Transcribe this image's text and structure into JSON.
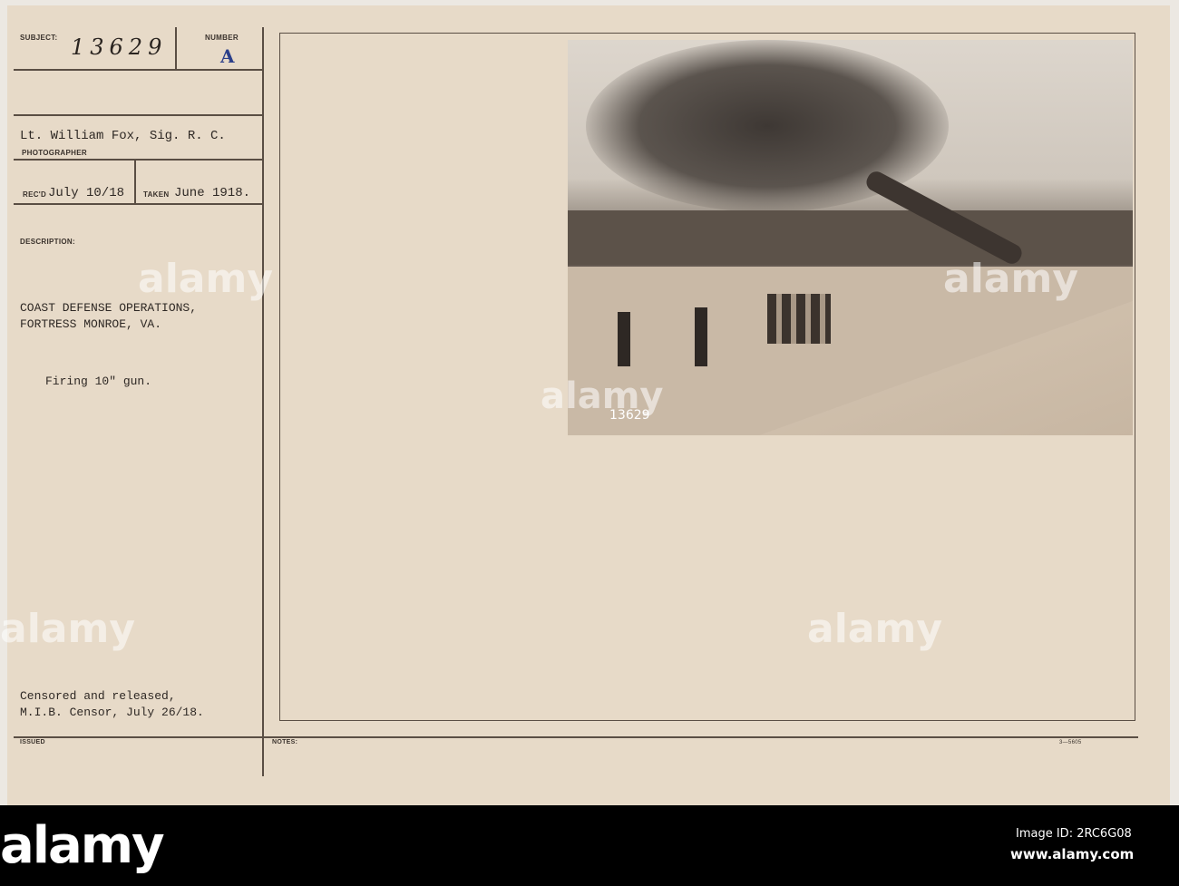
{
  "card": {
    "subject_label": "SUBJECT:",
    "subject_value": "13629",
    "number_label": "NUMBER",
    "number_value": "A",
    "photographer_name": "Lt. William Fox, Sig. R. C.",
    "photographer_label": "PHOTOGRAPHER",
    "recd_label": "REC'D",
    "recd_value": "July 10/18",
    "taken_label": "TAKEN",
    "taken_value": "June 1918.",
    "description_label": "DESCRIPTION:",
    "description_line1": "COAST DEFENSE OPERATIONS,",
    "description_line2": "FORTRESS MONROE, VA.",
    "description_line3": "Firing 10\" gun.",
    "censor_line1": "Censored and released,",
    "censor_line2": "M.I.B. Censor, July 26/18.",
    "issued_label": "ISSUED",
    "notes_label": "NOTES:",
    "form_number": "3—5605",
    "photo_caption": "13629"
  },
  "watermark": "alamy",
  "footer": {
    "image_id": "Image ID: 2RC6G08",
    "url": "www.alamy.com"
  }
}
